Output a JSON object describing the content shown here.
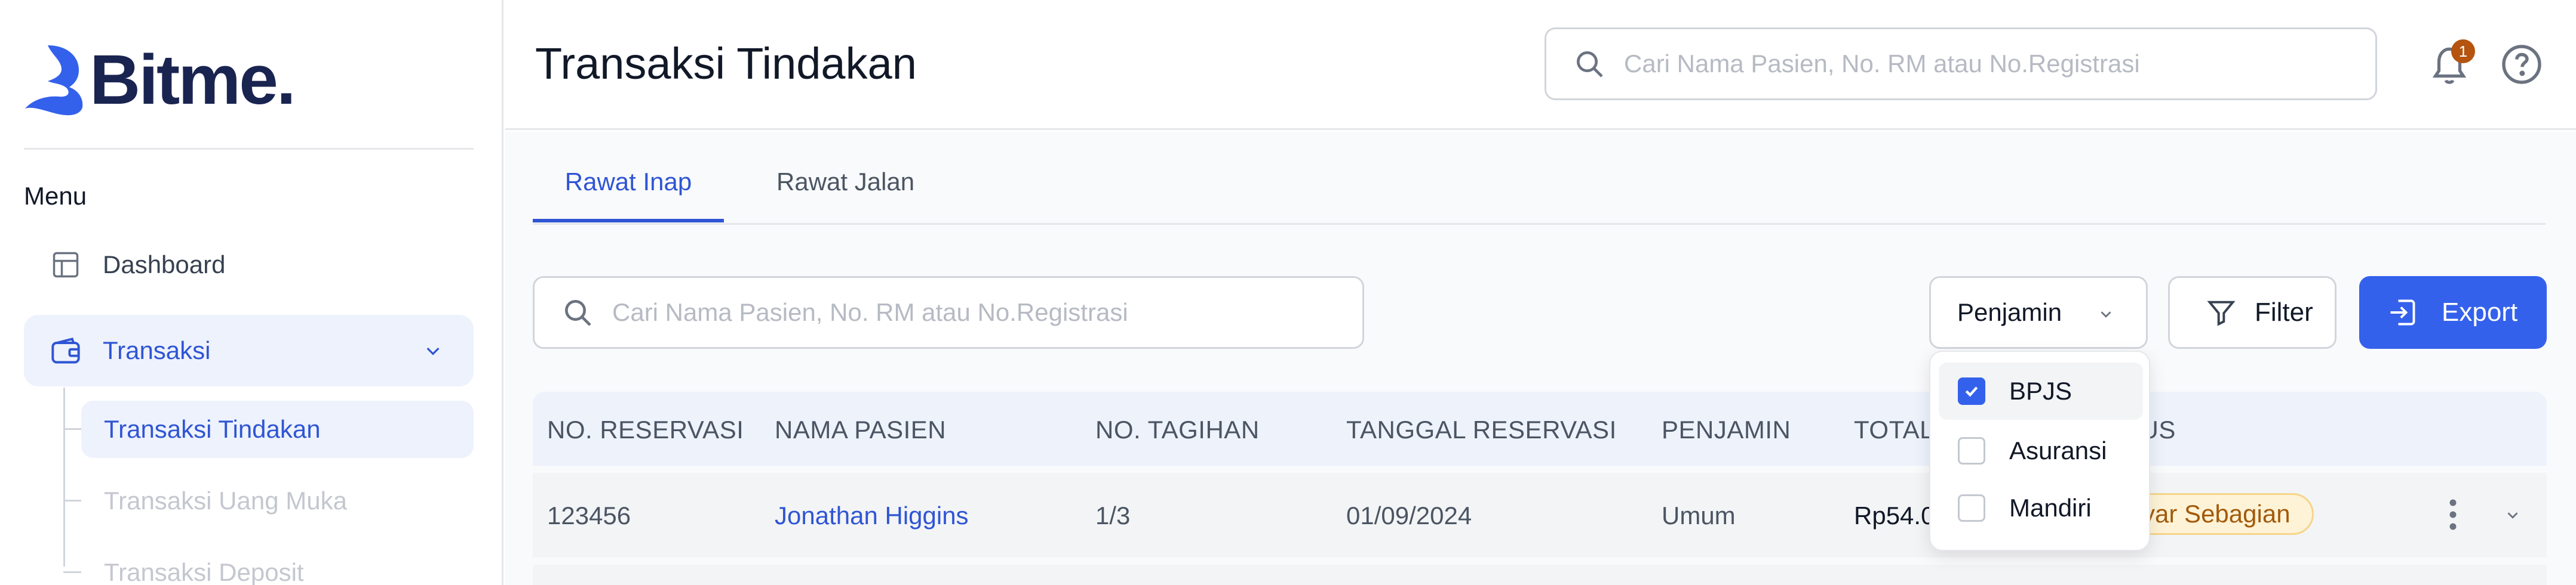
{
  "app": {
    "brand": "Bitme.",
    "colors": {
      "accent": "#3461ec",
      "brand_dark": "#1a2450",
      "badge_bg": "#b4540f",
      "status_warn": "#fef3d7"
    }
  },
  "sidebar": {
    "menu_heading": "Menu",
    "items": [
      {
        "label": "Dashboard",
        "icon": "dashboard-icon"
      },
      {
        "label": "Transaksi",
        "icon": "wallet-icon",
        "expanded": true
      }
    ],
    "subitems": [
      {
        "label": "Transaksi Tindakan",
        "active": true
      },
      {
        "label": "Transaksi Uang Muka",
        "active": false
      },
      {
        "label": "Transaksi Deposit",
        "active": false
      }
    ]
  },
  "header": {
    "title": "Transaksi Tindakan",
    "search_placeholder": "Cari Nama Pasien, No. RM atau No.Registrasi",
    "notification_count": "1"
  },
  "main": {
    "tabs": [
      {
        "label": "Rawat Inap",
        "active": true
      },
      {
        "label": "Rawat Jalan",
        "active": false
      }
    ],
    "search_placeholder": "Cari Nama Pasien, No. RM atau No.Registrasi",
    "penjamin_label": "Penjamin",
    "filter_label": "Filter",
    "export_label": "Export",
    "dropdown_options": [
      {
        "label": "BPJS",
        "checked": true
      },
      {
        "label": "Asuransi",
        "checked": false
      },
      {
        "label": "Mandiri",
        "checked": false
      }
    ],
    "table": {
      "columns": [
        "NO. RESERVASI",
        "NAMA PASIEN",
        "NO. TAGIHAN",
        "TANGGAL RESERVASI",
        "PENJAMIN",
        "TOTAL",
        "STATUS"
      ],
      "visible_column_headers": [
        "NO. RESERVASI",
        "NAMA PASIEN",
        "NO. TAGIHAN",
        "TANGGAL RESERVASI",
        "PENJAMIN",
        "TOTAL",
        "ATUS"
      ],
      "rows": [
        {
          "no_reservasi": "123456",
          "nama_pasien": "Jonathan Higgins",
          "no_tagihan": "1/3",
          "tanggal_reservasi": "01/09/2024",
          "penjamin": "Umum",
          "total_visible": "Rp54.0",
          "status_visible": "ibayar Sebagian"
        }
      ]
    }
  }
}
